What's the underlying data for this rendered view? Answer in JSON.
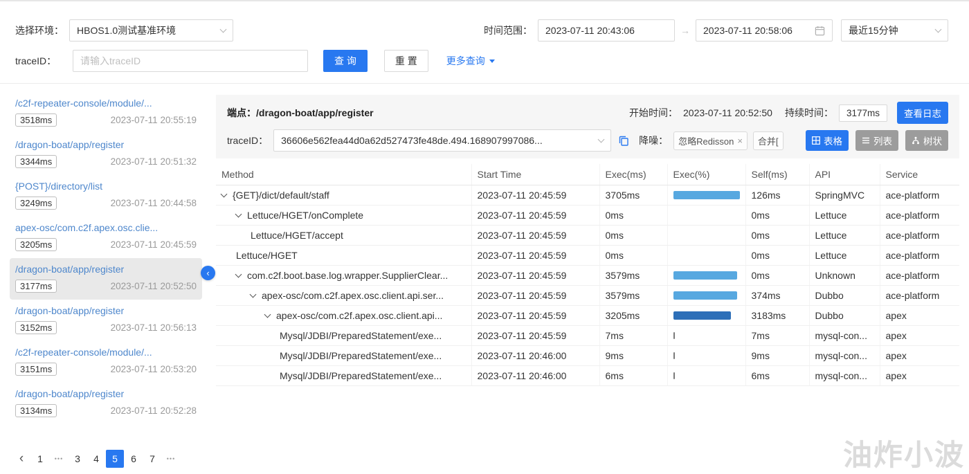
{
  "filters": {
    "env_label": "选择环境：",
    "env_value": "HBOS1.0测试基准环境",
    "time_label": "时间范围：",
    "time_start": "2023-07-11 20:43:06",
    "time_end": "2023-07-11 20:58:06",
    "time_preset": "最近15分钟",
    "trace_label": "traceID：",
    "trace_placeholder": "请输入traceID",
    "query": "查 询",
    "reset": "重 置",
    "more": "更多查询"
  },
  "icons": {
    "range_arrow": "→",
    "tag_close": "×",
    "collapse": "‹"
  },
  "sidebar": {
    "items": [
      {
        "path": "/c2f-repeater-console/module/...",
        "duration": "3518ms",
        "time": "2023-07-11 20:55:19",
        "selected": false
      },
      {
        "path": "/dragon-boat/app/register",
        "duration": "3344ms",
        "time": "2023-07-11 20:51:32",
        "selected": false
      },
      {
        "path": "{POST}/directory/list",
        "duration": "3249ms",
        "time": "2023-07-11 20:44:58",
        "selected": false
      },
      {
        "path": "apex-osc/com.c2f.apex.osc.clie...",
        "duration": "3205ms",
        "time": "2023-07-11 20:45:59",
        "selected": false
      },
      {
        "path": "/dragon-boat/app/register",
        "duration": "3177ms",
        "time": "2023-07-11 20:52:50",
        "selected": true
      },
      {
        "path": "/dragon-boat/app/register",
        "duration": "3152ms",
        "time": "2023-07-11 20:56:13",
        "selected": false
      },
      {
        "path": "/c2f-repeater-console/module/...",
        "duration": "3151ms",
        "time": "2023-07-11 20:53:20",
        "selected": false
      },
      {
        "path": "/dragon-boat/app/register",
        "duration": "3134ms",
        "time": "2023-07-11 20:52:28",
        "selected": false
      }
    ],
    "pagination": {
      "prev": "‹",
      "items": [
        "1",
        "•••",
        "3",
        "4",
        "5",
        "6",
        "7",
        "•••"
      ],
      "current": "5"
    }
  },
  "detail": {
    "endpoint_label": "端点：",
    "endpoint_value": "/dragon-boat/app/register",
    "start_label": "开始时间：",
    "start_value": "2023-07-11 20:52:50",
    "duration_label": "持续时间：",
    "duration_value": "3177ms",
    "view_logs": "查看日志",
    "traceid_label": "traceID：",
    "traceid_value": "36606e562fea44d0a62d527473fe48de.494.168907997086...",
    "noise_label": "降噪：",
    "tag1": "忽略Redisson",
    "tag2": "合并[",
    "views": {
      "table": "表格",
      "list": "列表",
      "tree": "树状"
    }
  },
  "table": {
    "columns": [
      "Method",
      "Start Time",
      "Exec(ms)",
      "Exec(%)",
      "Self(ms)",
      "API",
      "Service"
    ],
    "rows": [
      {
        "method": "{GET}/dict/default/staff",
        "indent": 0,
        "caret": true,
        "start": "2023-07-11 20:45:59",
        "exec": "3705ms",
        "pct": 100,
        "bar": "light",
        "self": "126ms",
        "api": "SpringMVC",
        "service": "ace-platform"
      },
      {
        "method": "Lettuce/HGET/onComplete",
        "indent": 1,
        "caret": true,
        "start": "2023-07-11 20:45:59",
        "exec": "0ms",
        "pct": 0,
        "bar": "none",
        "self": "0ms",
        "api": "Lettuce",
        "service": "ace-platform"
      },
      {
        "method": "Lettuce/HGET/accept",
        "indent": 2,
        "caret": false,
        "start": "2023-07-11 20:45:59",
        "exec": "0ms",
        "pct": 0,
        "bar": "none",
        "self": "0ms",
        "api": "Lettuce",
        "service": "ace-platform"
      },
      {
        "method": "Lettuce/HGET",
        "indent": 1,
        "caret": false,
        "start": "2023-07-11 20:45:59",
        "exec": "0ms",
        "pct": 0,
        "bar": "none",
        "self": "0ms",
        "api": "Lettuce",
        "service": "ace-platform"
      },
      {
        "method": "com.c2f.boot.base.log.wrapper.SupplierClear...",
        "indent": 1,
        "caret": true,
        "start": "2023-07-11 20:45:59",
        "exec": "3579ms",
        "pct": 96.6,
        "bar": "light",
        "self": "0ms",
        "api": "Unknown",
        "service": "ace-platform"
      },
      {
        "method": "apex-osc/com.c2f.apex.osc.client.api.ser...",
        "indent": 2,
        "caret": true,
        "start": "2023-07-11 20:45:59",
        "exec": "3579ms",
        "pct": 96.6,
        "bar": "light",
        "self": "374ms",
        "api": "Dubbo",
        "service": "ace-platform"
      },
      {
        "method": "apex-osc/com.c2f.apex.osc.client.api...",
        "indent": 3,
        "caret": true,
        "start": "2023-07-11 20:45:59",
        "exec": "3205ms",
        "pct": 86.5,
        "bar": "dark",
        "self": "3183ms",
        "api": "Dubbo",
        "service": "apex"
      },
      {
        "method": "Mysql/JDBI/PreparedStatement/exe...",
        "indent": 4,
        "caret": false,
        "start": "2023-07-11 20:45:59",
        "exec": "7ms",
        "pct": 0.2,
        "bar": "tick",
        "self": "7ms",
        "api": "mysql-con...",
        "service": "apex"
      },
      {
        "method": "Mysql/JDBI/PreparedStatement/exe...",
        "indent": 4,
        "caret": false,
        "start": "2023-07-11 20:46:00",
        "exec": "9ms",
        "pct": 0.2,
        "bar": "tick",
        "self": "9ms",
        "api": "mysql-con...",
        "service": "apex"
      },
      {
        "method": "Mysql/JDBI/PreparedStatement/exe...",
        "indent": 4,
        "caret": false,
        "start": "2023-07-11 20:46:00",
        "exec": "6ms",
        "pct": 0.2,
        "bar": "tick",
        "self": "6ms",
        "api": "mysql-con...",
        "service": "apex"
      }
    ]
  },
  "colors": {
    "primary": "#2878f0",
    "link": "#4e87cc",
    "bar_light": "#57a8e0",
    "bar_dark": "#2d6fb8",
    "selected_bg": "#e9e9e9"
  },
  "watermark": "油炸小波"
}
